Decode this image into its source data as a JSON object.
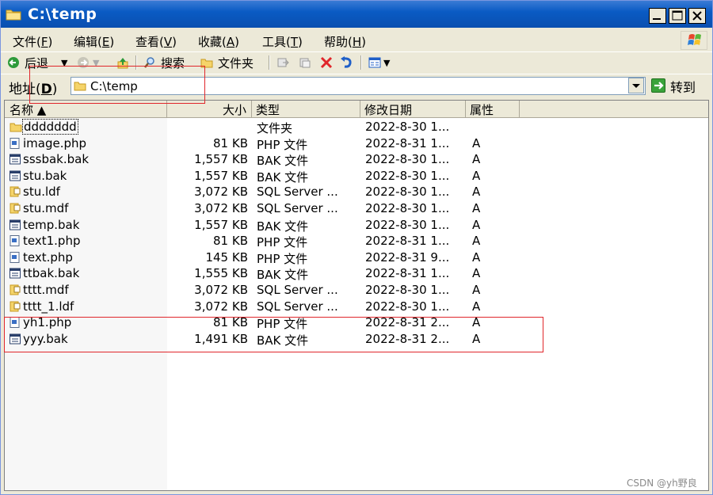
{
  "window": {
    "title": "C:\\temp"
  },
  "menu": [
    {
      "label": "文件(",
      "key": "F",
      "end": ")"
    },
    {
      "label": "编辑(",
      "key": "E",
      "end": ")"
    },
    {
      "label": "查看(",
      "key": "V",
      "end": ")"
    },
    {
      "label": "收藏(",
      "key": "A",
      "end": ")"
    },
    {
      "label": "工具(",
      "key": "T",
      "end": ")"
    },
    {
      "label": "帮助(",
      "key": "H",
      "end": ")"
    }
  ],
  "toolbar": {
    "back_label": "后退",
    "search_label": "搜索",
    "folders_label": "文件夹"
  },
  "address": {
    "label_prefix": "地址(",
    "label_key": "D",
    "label_suffix": ")",
    "value": "C:\\temp",
    "go_label": "转到"
  },
  "columns": {
    "name": "名称 ▲",
    "size": "大小",
    "type": "类型",
    "modified": "修改日期",
    "attributes": "属性"
  },
  "files": [
    {
      "name": "ddddddd",
      "size": "",
      "type": "文件夹",
      "modified": "2022-8-30 1...",
      "attr": "",
      "icon": "folder-icon"
    },
    {
      "name": "image.php",
      "size": "81 KB",
      "type": "PHP 文件",
      "modified": "2022-8-31 1...",
      "attr": "A",
      "icon": "php-file-icon"
    },
    {
      "name": "sssbak.bak",
      "size": "1,557 KB",
      "type": "BAK 文件",
      "modified": "2022-8-30 1...",
      "attr": "A",
      "icon": "bak-file-icon"
    },
    {
      "name": "stu.bak",
      "size": "1,557 KB",
      "type": "BAK 文件",
      "modified": "2022-8-30 1...",
      "attr": "A",
      "icon": "bak-file-icon"
    },
    {
      "name": "stu.ldf",
      "size": "3,072 KB",
      "type": "SQL Server ...",
      "modified": "2022-8-30 1...",
      "attr": "A",
      "icon": "sql-file-icon"
    },
    {
      "name": "stu.mdf",
      "size": "3,072 KB",
      "type": "SQL Server ...",
      "modified": "2022-8-30 1...",
      "attr": "A",
      "icon": "sql-file-icon"
    },
    {
      "name": "temp.bak",
      "size": "1,557 KB",
      "type": "BAK 文件",
      "modified": "2022-8-30 1...",
      "attr": "A",
      "icon": "bak-file-icon"
    },
    {
      "name": "text1.php",
      "size": "81 KB",
      "type": "PHP 文件",
      "modified": "2022-8-31 1...",
      "attr": "A",
      "icon": "php-file-icon"
    },
    {
      "name": "text.php",
      "size": "145 KB",
      "type": "PHP 文件",
      "modified": "2022-8-31 9...",
      "attr": "A",
      "icon": "php-file-icon"
    },
    {
      "name": "ttbak.bak",
      "size": "1,555 KB",
      "type": "BAK 文件",
      "modified": "2022-8-31 1...",
      "attr": "A",
      "icon": "bak-file-icon"
    },
    {
      "name": "tttt.mdf",
      "size": "3,072 KB",
      "type": "SQL Server ...",
      "modified": "2022-8-30 1...",
      "attr": "A",
      "icon": "sql-file-icon"
    },
    {
      "name": "tttt_1.ldf",
      "size": "3,072 KB",
      "type": "SQL Server ...",
      "modified": "2022-8-30 1...",
      "attr": "A",
      "icon": "sql-file-icon"
    },
    {
      "name": "yh1.php",
      "size": "81 KB",
      "type": "PHP 文件",
      "modified": "2022-8-31 2...",
      "attr": "A",
      "icon": "php-file-icon"
    },
    {
      "name": "yyy.bak",
      "size": "1,491 KB",
      "type": "BAK 文件",
      "modified": "2022-8-31 2...",
      "attr": "A",
      "icon": "bak-file-icon"
    }
  ],
  "watermark": "CSDN @yh野良",
  "colors": {
    "titlebar": "#0a5bc4",
    "annotation": "#e0262b",
    "chrome": "#ece9d8"
  }
}
